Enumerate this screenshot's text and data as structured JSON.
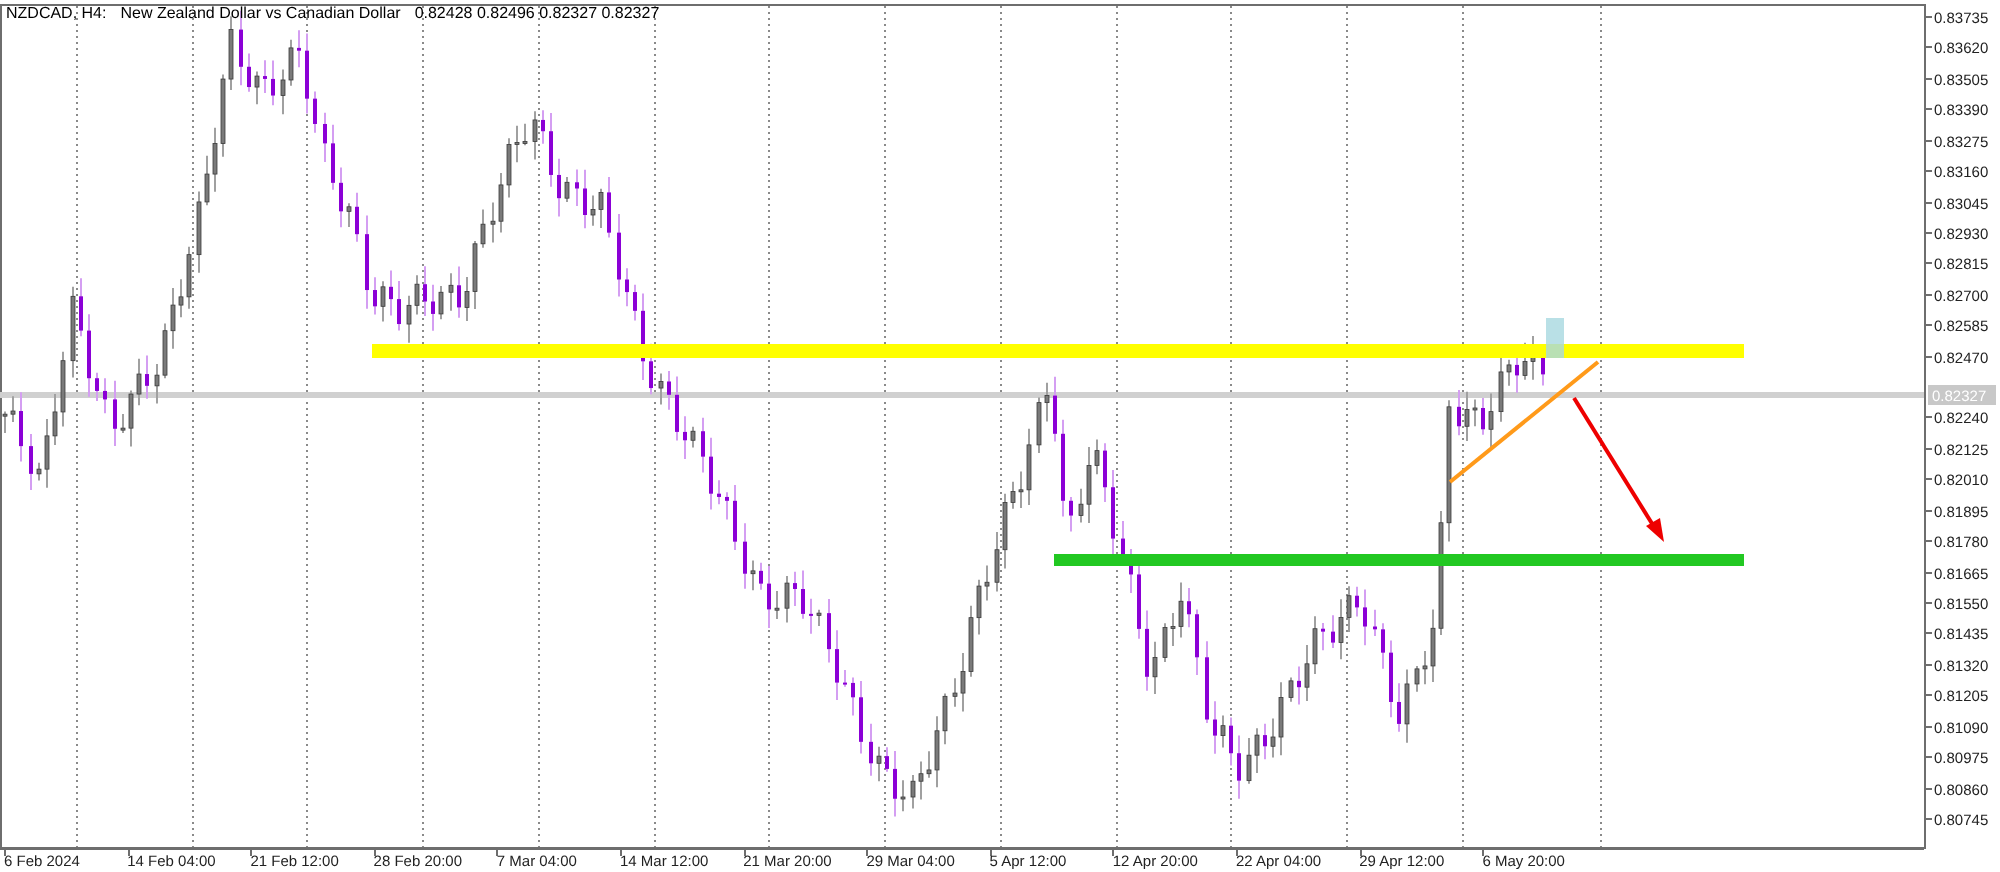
{
  "chart_header": {
    "symbol": "NZDCAD, H4:",
    "description": "New Zealand Dollar vs Canadian Dollar",
    "quote": "0.82428 0.82496 0.82327 0.82327"
  },
  "price_axis": {
    "labels": [
      "0.83735",
      "0.83620",
      "0.83505",
      "0.83390",
      "0.83275",
      "0.83160",
      "0.83045",
      "0.82930",
      "0.82815",
      "0.82700",
      "0.82585",
      "0.82470",
      "0.82240",
      "0.82125",
      "0.82010",
      "0.81895",
      "0.81780",
      "0.81665",
      "0.81550",
      "0.81435",
      "0.81320",
      "0.81205",
      "0.81090",
      "0.80975",
      "0.80860",
      "0.80745"
    ],
    "current_price": "0.82327"
  },
  "time_axis": {
    "labels": [
      "6 Feb 2024",
      "14 Feb 04:00",
      "21 Feb 12:00",
      "28 Feb 20:00",
      "7 Mar 04:00",
      "14 Mar 12:00",
      "21 Mar 20:00",
      "29 Mar 04:00",
      "5 Apr 12:00",
      "12 Apr 20:00",
      "22 Apr 04:00",
      "29 Apr 12:00",
      "6 May 20:00"
    ]
  }
}
